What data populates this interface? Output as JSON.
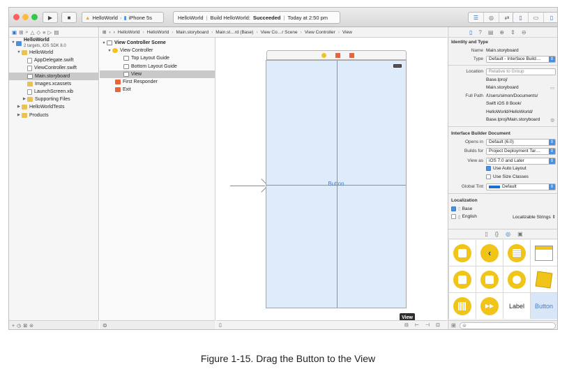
{
  "toolbar": {
    "scheme_target": "HelloWorld",
    "scheme_device": "iPhone 5s",
    "status_project": "HelloWorld",
    "status_text": "Build HelloWorld:",
    "status_result": "Succeeded",
    "status_time": "Today at 2:50 pm"
  },
  "navigator": {
    "project": "HelloWorld",
    "project_sub": "2 targets, iOS SDK 8.0",
    "items": [
      {
        "label": "HelloWorld"
      },
      {
        "label": "AppDelegate.swift"
      },
      {
        "label": "ViewController.swift"
      },
      {
        "label": "Main.storyboard"
      },
      {
        "label": "Images.xcassets"
      },
      {
        "label": "LaunchScreen.xib"
      },
      {
        "label": "Supporting Files"
      },
      {
        "label": "HelloWorldTests"
      },
      {
        "label": "Products"
      }
    ]
  },
  "jumpbar": [
    "HelloWorld",
    "HelloWorld",
    "Main.storyboard",
    "Main.st…rd (Base)",
    "View Co…r Scene",
    "View Controller",
    "View"
  ],
  "outline": {
    "scene": "View Controller Scene",
    "controller": "View Controller",
    "items": [
      "Top Layout Guide",
      "Bottom Layout Guide",
      "View"
    ],
    "first_responder": "First Responder",
    "exit": "Exit"
  },
  "canvas": {
    "button_label": "Button",
    "tooltip": "View"
  },
  "inspector": {
    "identity_title": "Identity and Type",
    "name_label": "Name",
    "name_value": "Main.storyboard",
    "type_label": "Type",
    "type_value": "Default - Interface Build…",
    "location_label": "Location",
    "location_value": "Relative to Group",
    "location_path_1": "Base.lproj/",
    "location_path_2": "Main.storyboard",
    "fullpath_label": "Full Path",
    "fullpath_1": "/Users/simon/Documents/",
    "fullpath_2": "Swift iOS 8 Book/",
    "fullpath_3": "HelloWorld/HelloWorld/",
    "fullpath_4": "Base.lproj/Main.storyboard",
    "ibdoc_title": "Interface Builder Document",
    "opens_label": "Opens in",
    "opens_value": "Default (6.0)",
    "builds_label": "Builds for",
    "builds_value": "Project Deployment Tar…",
    "viewas_label": "View as",
    "viewas_value": "iOS 7.0 and Later",
    "autolayout_label": "Use Auto Layout",
    "sizeclasses_label": "Use Size Classes",
    "tint_label": "Global Tint",
    "tint_value": "Default",
    "tint_color": "#1a6fd6",
    "localization_title": "Localization",
    "loc_base": "Base",
    "loc_english": "English",
    "loc_english_value": "Localizable Strings"
  },
  "library": {
    "label_cell": "Label",
    "button_cell": "Button"
  },
  "caption": "Figure 1-15. Drag the Button to the View"
}
